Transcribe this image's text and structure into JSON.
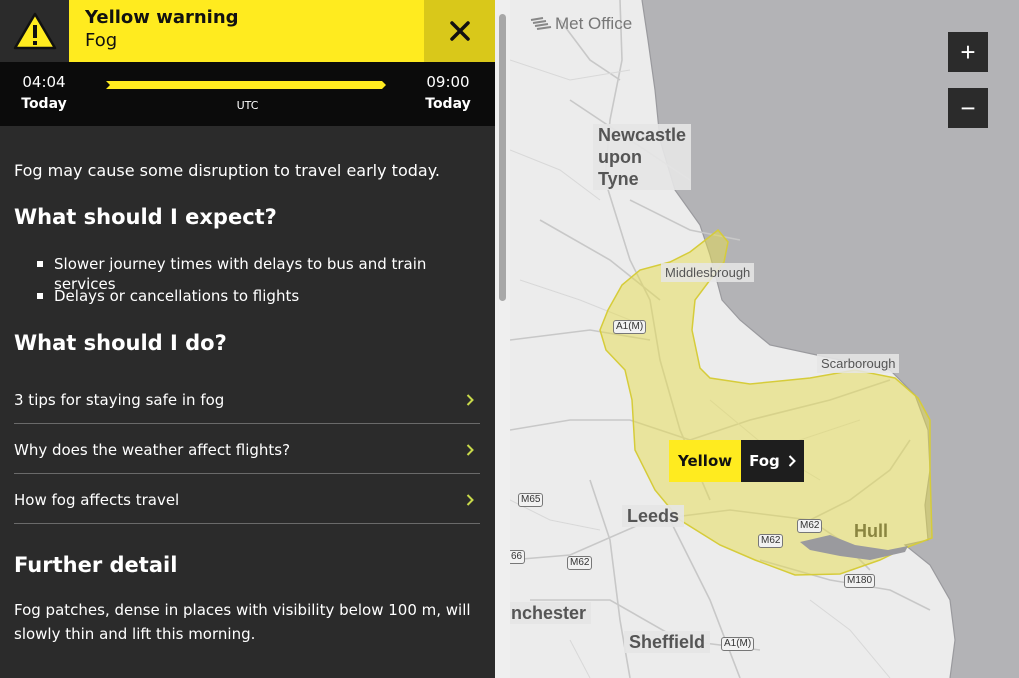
{
  "warning": {
    "level": "Yellow warning",
    "type": "Fog",
    "close_icon": "close-icon",
    "alert_icon": "warning-triangle-icon",
    "color": "#ffeb1f"
  },
  "timeline": {
    "start_time": "04:04",
    "start_day": "Today",
    "end_time": "09:00",
    "end_day": "Today",
    "timezone": "UTC"
  },
  "content": {
    "summary": "Fog may cause some disruption to travel early today.",
    "expect_heading": "What should I expect?",
    "expect_items": [
      "Slower journey times with delays to bus and train services",
      "Delays or cancellations to flights"
    ],
    "do_heading": "What should I do?",
    "links": [
      "3 tips for staying safe in fog",
      "Why does the weather affect flights?",
      "How fog affects travel"
    ],
    "further_heading": "Further detail",
    "further_text": "Fog patches, dense in places with visibility below 100 m, will slowly thin and lift this morning."
  },
  "map": {
    "logo": "Met Office",
    "zoom_in": "+",
    "zoom_out": "−",
    "tag_level": "Yellow",
    "tag_type": "Fog",
    "places": {
      "newcastle": "Newcastle upon Tyne",
      "middlesbrough": "Middlesbrough",
      "scarborough": "Scarborough",
      "leeds": "Leeds",
      "hull": "Hull",
      "manchester": "nchester",
      "sheffield": "Sheffield"
    },
    "roads": {
      "a1m_north": "A1(M)",
      "m65": "M65",
      "m66": "66",
      "m62_west": "M62",
      "m62_mid": "M62",
      "m62_east": "M62",
      "m180": "M180",
      "a1m_south": "A1(M)"
    }
  }
}
